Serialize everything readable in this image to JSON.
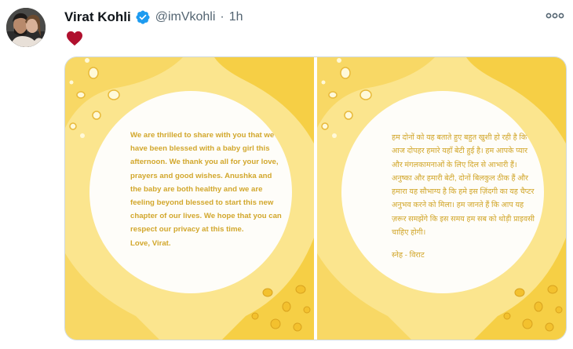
{
  "tweet": {
    "author_name": "Virat Kohli",
    "handle": "@imVkohli",
    "separator": "·",
    "time": "1h",
    "verified": true,
    "reaction_icon": "heart-icon",
    "more_icon": "more-options-icon"
  },
  "images": {
    "english": {
      "lines": [
        "We are thrilled to share with you that we",
        "have been blessed with a baby girl this",
        "afternoon. We thank you all for your love,",
        "prayers and good wishes. Anushka and",
        "the baby are both healthy and we are",
        "feeling beyond blessed to start this new",
        "chapter of our lives. We hope that you can",
        "respect our privacy at this time."
      ],
      "signoff": "Love, Virat."
    },
    "hindi": {
      "lines": [
        "हम दोनों को यह बताते हुए बहुत खुशी हो रही है कि",
        "आज दोपहर हमारे यहाँ बेटी हुई है। हम आपके प्यार",
        "और मंगलकामनाओं के लिए दिल से आभारी हैं।",
        "अनुष्का और हमारी बेटी, दोनों बिलकुल ठीक हैं और",
        "हमारा यह सौभाग्य है कि हमे इस ज़िंदगी का यह चैप्टर",
        "अनुभव करने को मिला। हम जानते हैं कि आप यह",
        "ज़रूर समझेंगे कि इस समय हम सब को थोड़ी प्राइवसी",
        "चाहिए होगी।"
      ],
      "signoff": "स्नेह - विराट"
    }
  },
  "colors": {
    "accent_blue": "#1d9bf0",
    "heart_red": "#b0102e",
    "card_yellow": "#fbe58e",
    "deep_yellow": "#f6cf45",
    "text_gold": "#d2a72c"
  }
}
